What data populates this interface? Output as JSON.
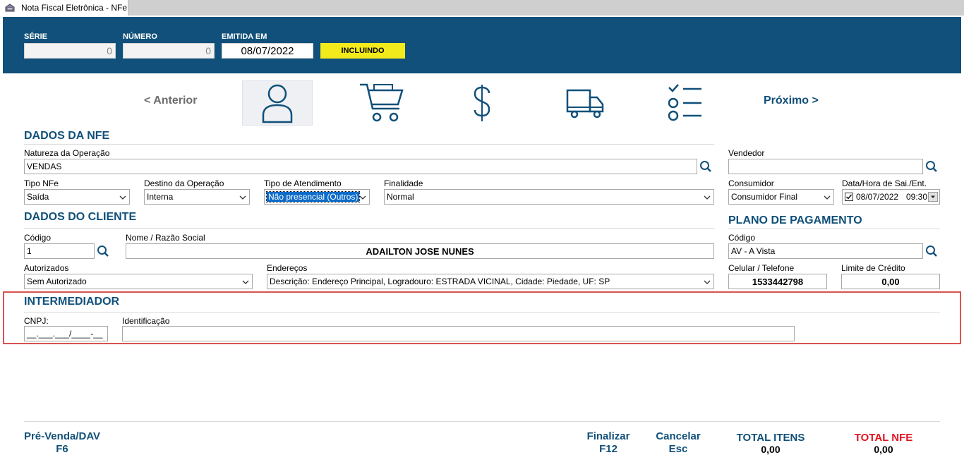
{
  "window": {
    "title": "Nota Fiscal Eletrônica - NFe"
  },
  "header": {
    "serie_label": "SÉRIE",
    "serie_value": "0",
    "numero_label": "NÚMERO",
    "numero_value": "0",
    "emitida_label": "EMITIDA EM",
    "emitida_value": "08/07/2022",
    "status": "INCLUINDO",
    "status_color": "#f3ea1c",
    "bg_color": "#10507a"
  },
  "nav": {
    "prev_label": "< Anterior",
    "next_label": "Próximo >",
    "steps": [
      {
        "icon": "user-icon",
        "active": true
      },
      {
        "icon": "cart-icon",
        "active": false
      },
      {
        "icon": "dollar-icon",
        "active": false
      },
      {
        "icon": "truck-icon",
        "active": false
      },
      {
        "icon": "checklist-icon",
        "active": false
      }
    ]
  },
  "dados_nfe": {
    "title": "DADOS DA NFE",
    "natureza_label": "Natureza da Operação",
    "natureza_value": "VENDAS",
    "vendedor_label": "Vendedor",
    "vendedor_value": "",
    "tipo_nfe_label": "Tipo NFe",
    "tipo_nfe_value": "Saída",
    "destino_label": "Destino da Operação",
    "destino_value": "Interna",
    "atendimento_label": "Tipo de Atendimento",
    "atendimento_value": "Não presencial (Outros)",
    "finalidade_label": "Finalidade",
    "finalidade_value": "Normal",
    "consumidor_label": "Consumidor",
    "consumidor_value": "Consumidor Final",
    "data_hora_label": "Data/Hora de Sai./Ent.",
    "data_value": "08/07/2022",
    "hora_value": "09:30",
    "data_checked": true
  },
  "dados_cliente": {
    "title": "DADOS DO CLIENTE",
    "codigo_label": "Código",
    "codigo_value": "1",
    "nome_label": "Nome / Razão Social",
    "nome_value": "ADAILTON JOSE NUNES",
    "autorizados_label": "Autorizados",
    "autorizados_value": "Sem Autorizado",
    "enderecos_label": "Endereços",
    "enderecos_value": "Descrição: Endereço Principal, Logradouro: ESTRADA VICINAL, Cidade: Piedade, UF: SP"
  },
  "plano_pagamento": {
    "title": "PLANO DE PAGAMENTO",
    "codigo_label": "Código",
    "codigo_value": "AV - A Vista",
    "celular_label": "Celular / Telefone",
    "celular_value": "1533442798",
    "limite_label": "Limite de Crédito",
    "limite_value": "0,00"
  },
  "intermediador": {
    "title": "INTERMEDIADOR",
    "cnpj_label": "CNPJ:",
    "cnpj_value": "__.___.___/____-__",
    "identificacao_label": "Identificação",
    "identificacao_value": "",
    "highlight_color": "#d9534f"
  },
  "footer": {
    "prevenda_label": "Pré-Venda/DAV",
    "prevenda_key": "F6",
    "finalizar_label": "Finalizar",
    "finalizar_key": "F12",
    "cancelar_label": "Cancelar",
    "cancelar_key": "Esc",
    "total_itens_label": "TOTAL ITENS",
    "total_itens_value": "0,00",
    "total_nfe_label": "TOTAL NFE",
    "total_nfe_value": "0,00",
    "total_nfe_color": "#e0141e"
  }
}
